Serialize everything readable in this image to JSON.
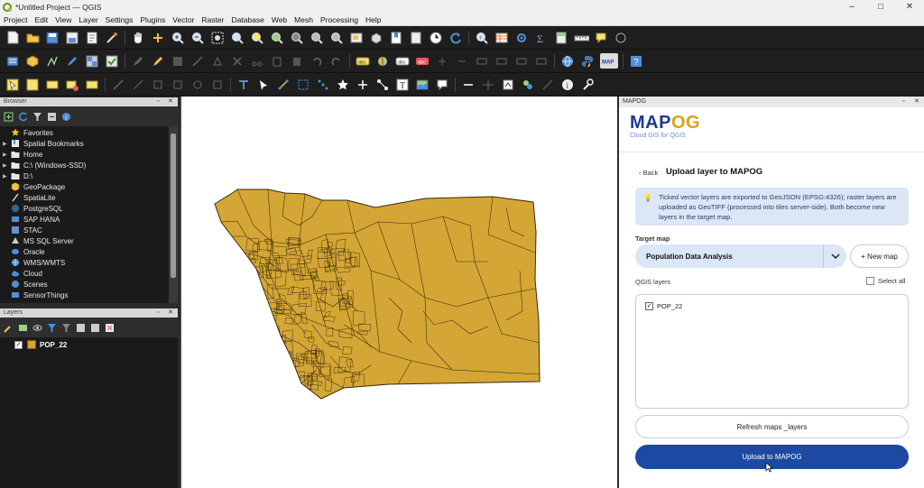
{
  "window": {
    "title": "*Untitled Project — QGIS",
    "controls": [
      "–",
      "□",
      "✕"
    ]
  },
  "menu": [
    "Project",
    "Edit",
    "View",
    "Layer",
    "Settings",
    "Plugins",
    "Vector",
    "Raster",
    "Database",
    "Web",
    "Mesh",
    "Processing",
    "Help"
  ],
  "browser": {
    "panel_title": "Browser",
    "items": [
      {
        "label": "Favorites",
        "icon": "star-icon",
        "expand": false
      },
      {
        "label": "Spatial Bookmarks",
        "icon": "bookmark-icon",
        "expand": true
      },
      {
        "label": "Home",
        "icon": "folder-icon",
        "expand": true
      },
      {
        "label": "C:\\ (Windows-SSD)",
        "icon": "drive-icon",
        "expand": true
      },
      {
        "label": "D:\\",
        "icon": "drive-icon",
        "expand": true
      },
      {
        "label": "GeoPackage",
        "icon": "geopackage-icon",
        "expand": false
      },
      {
        "label": "SpatiaLite",
        "icon": "spatialite-icon",
        "expand": false
      },
      {
        "label": "PostgreSQL",
        "icon": "postgresql-icon",
        "expand": false
      },
      {
        "label": "SAP HANA",
        "icon": "sap-hana-icon",
        "expand": false
      },
      {
        "label": "STAC",
        "icon": "stac-icon",
        "expand": false
      },
      {
        "label": "MS SQL Server",
        "icon": "mssql-icon",
        "expand": false
      },
      {
        "label": "Oracle",
        "icon": "oracle-icon",
        "expand": false
      },
      {
        "label": "WMS/WMTS",
        "icon": "wms-icon",
        "expand": false
      },
      {
        "label": "Cloud",
        "icon": "cloud-icon",
        "expand": false
      },
      {
        "label": "Scenes",
        "icon": "scenes-icon",
        "expand": false
      },
      {
        "label": "SensorThings",
        "icon": "sensorthings-icon",
        "expand": false
      }
    ]
  },
  "layers_panel": {
    "panel_title": "Layers",
    "layers": [
      {
        "name": "POP_22",
        "checked": true,
        "fill_color": "#dba336"
      }
    ]
  },
  "map": {
    "fill_color": "#d4a636",
    "stroke_color": "#3a2a08"
  },
  "mapog": {
    "panel_title": "MAPOG",
    "logo_main": "MAP",
    "logo_accent": "OG",
    "tagline": "Cloud GIS for QGIS",
    "back_label": "‹ Back",
    "title": "Upload layer to MAPOG",
    "info_text": "Ticked vector layers are exported to GeoJSON (EPSG:4326); raster layers are uploaded as GeoTIFF (processed into tiles server-side). Both become new layers in the target map.",
    "target_map_label": "Target map",
    "target_map_value": "Population Data Analysis",
    "new_map_label": "+ New map",
    "qgis_layers_label": "QGIS layers",
    "select_all_label": "Select all",
    "layer_entries": [
      {
        "name": "POP_22",
        "checked": true
      }
    ],
    "refresh_label": "Refresh maps _layers",
    "upload_label": "Upload to MAPOG",
    "brand_blue": "#1f3a8f",
    "brand_gold": "#d9a21b",
    "button_blue": "#1d49a3"
  }
}
